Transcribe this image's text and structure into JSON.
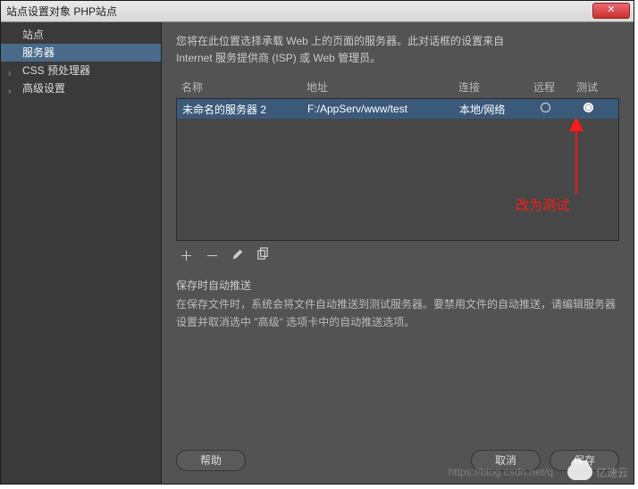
{
  "title": "站点设置对象 PHP站点",
  "close_label": "✕",
  "sidebar": {
    "items": [
      {
        "label": "站点",
        "expandable": false
      },
      {
        "label": "服务器",
        "expandable": false,
        "selected": true
      },
      {
        "label": "CSS 预处理器",
        "expandable": true
      },
      {
        "label": "高级设置",
        "expandable": true
      }
    ]
  },
  "intro": {
    "line1": "您将在此位置选择承载 Web 上的页面的服务器。此对话框的设置来自",
    "line2": "Internet 服务提供商 (ISP) 或 Web 管理员。"
  },
  "table": {
    "headers": {
      "name": "名称",
      "addr": "地址",
      "conn": "连接",
      "remote": "远程",
      "test": "测试"
    },
    "rows": [
      {
        "name": "未命名的服务器 2",
        "addr": "F:/AppServ/www/test",
        "conn": "本地/网络",
        "remote": false,
        "test": true
      }
    ]
  },
  "toolbar": {
    "add": "＋",
    "remove": "－",
    "edit": "pencil",
    "duplicate": "duplicate"
  },
  "auto_push": {
    "title": "保存时自动推送",
    "desc": "在保存文件时，系统会将文件自动推送到测试服务器。要禁用文件的自动推送，请编辑服务器设置并取消选中 \"高级\" 选项卡中的自动推送选项。"
  },
  "buttons": {
    "help": "帮助",
    "cancel": "取消",
    "save": "保存"
  },
  "annotation": {
    "text": "改为测试"
  },
  "watermark": {
    "brand": "亿速云",
    "url": "https://blog.csdn.net/q"
  }
}
